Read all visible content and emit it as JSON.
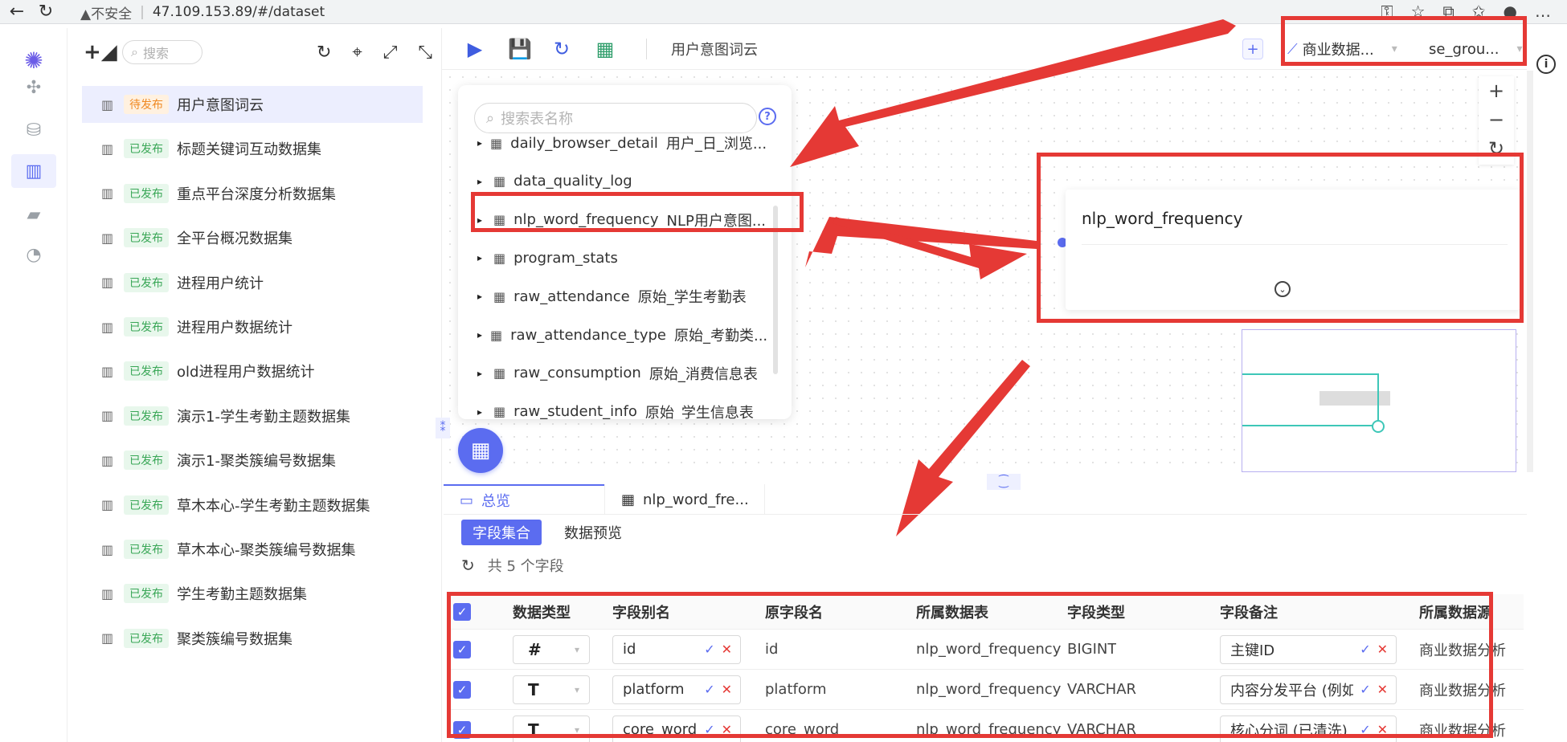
{
  "browser": {
    "insecure_label": "▲不安全",
    "url": "47.109.153.89/#/dataset"
  },
  "rail": {
    "items": [
      "apps-icon",
      "database-icon",
      "dataset-icon",
      "folder-icon",
      "gauge-icon"
    ]
  },
  "list_panel": {
    "search_placeholder": "搜索",
    "items": [
      {
        "status": "待发布",
        "name": "用户意图词云",
        "selected": true
      },
      {
        "status": "已发布",
        "name": "标题关键词互动数据集"
      },
      {
        "status": "已发布",
        "name": "重点平台深度分析数据集"
      },
      {
        "status": "已发布",
        "name": "全平台概况数据集"
      },
      {
        "status": "已发布",
        "name": "进程用户统计"
      },
      {
        "status": "已发布",
        "name": "进程用户数据统计"
      },
      {
        "status": "已发布",
        "name": "old进程用户数据统计"
      },
      {
        "status": "已发布",
        "name": "演示1-学生考勤主题数据集"
      },
      {
        "status": "已发布",
        "name": "演示1-聚类簇编号数据集"
      },
      {
        "status": "已发布",
        "name": "草木本心-学生考勤主题数据集"
      },
      {
        "status": "已发布",
        "name": "草木本心-聚类簇编号数据集"
      },
      {
        "status": "已发布",
        "name": "学生考勤主题数据集"
      },
      {
        "status": "已发布",
        "name": "聚类簇编号数据集"
      }
    ]
  },
  "main_toolbar": {
    "title": "用户意图词云",
    "datasource": "商业数据...",
    "schema": "se_grou..."
  },
  "table_popup": {
    "search_placeholder": "搜索表名称",
    "rows": [
      {
        "name": "daily_browser_detail",
        "comment": "用户_日_浏览..."
      },
      {
        "name": "data_quality_log",
        "comment": ""
      },
      {
        "name": "nlp_word_frequency",
        "comment": "NLP用户意图..."
      },
      {
        "name": "program_stats",
        "comment": ""
      },
      {
        "name": "raw_attendance",
        "comment": "原始_学生考勤表"
      },
      {
        "name": "raw_attendance_type",
        "comment": "原始_考勤类..."
      },
      {
        "name": "raw_consumption",
        "comment": "原始_消费信息表"
      },
      {
        "name": "raw_student_info",
        "comment": "原始_学生信息表"
      }
    ]
  },
  "node": {
    "title": "nlp_word_frequency"
  },
  "bottom_panel": {
    "tab_overview": "总览",
    "tab_table": "nlp_word_fre...",
    "sub_tab_fields": "字段集合",
    "sub_tab_preview": "数据预览",
    "count_text": "共 5 个字段",
    "headers": [
      "数据类型",
      "字段别名",
      "原字段名",
      "所属数据表",
      "字段类型",
      "字段备注",
      "所属数据源"
    ],
    "rows": [
      {
        "type_symbol": "#",
        "alias": "id",
        "orig": "id",
        "table": "nlp_word_frequency",
        "ftype": "BIGINT",
        "remark": "主键ID",
        "source": "商业数据分析"
      },
      {
        "type_symbol": "T",
        "alias": "platform",
        "orig": "platform",
        "table": "nlp_word_frequency",
        "ftype": "VARCHAR",
        "remark": "内容分发平台 (例如",
        "source": "商业数据分析"
      },
      {
        "type_symbol": "T",
        "alias": "core_word",
        "orig": "core_word",
        "table": "nlp_word_frequency",
        "ftype": "VARCHAR",
        "remark": "核心分词 (已清洗)",
        "source": "商业数据分析"
      }
    ]
  },
  "colors": {
    "accent": "#5b6cf0",
    "annotation_red": "#e53935",
    "published_green": "#3aa757",
    "pending_orange": "#f08a24"
  }
}
